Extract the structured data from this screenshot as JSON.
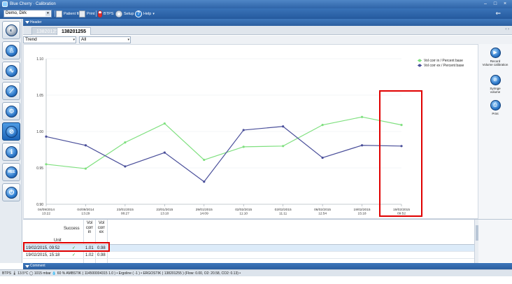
{
  "window": {
    "title": "Blue Cherry · Calibration",
    "minimize": "–",
    "restore": "□",
    "close": "×"
  },
  "toolbar": {
    "user": "Demo, Dirk",
    "patient_file": "Patient file",
    "print": "Print",
    "btps": "BTPS",
    "setup": "Setup",
    "help": "Help",
    "back": "⇐"
  },
  "header": {
    "label": "Header"
  },
  "tabs": [
    {
      "label": "138201255",
      "active": false
    },
    {
      "label": "138201255",
      "active": true
    }
  ],
  "filters": {
    "view": "Trend",
    "scope": "All",
    "arrow": "▾"
  },
  "chart_data": {
    "type": "line",
    "x": [
      "04/09/2014\n13:22",
      "04/09/2014\n13:29",
      "23/01/2015\n08:27",
      "23/01/2015\n13:10",
      "29/01/2015\n14:09",
      "02/02/2015\n11:10",
      "02/02/2015\n11:11",
      "06/02/2015\n12:54",
      "19/02/2015\n15:18",
      "19/02/2015\n09:52"
    ],
    "series": [
      {
        "name": "Vol corr in / Percent base",
        "color": "#7fe07f",
        "values": [
          0.955,
          0.949,
          0.985,
          1.011,
          0.961,
          0.979,
          0.98,
          1.009,
          1.02,
          1.009
        ]
      },
      {
        "name": "Vol corr ex / Percent base",
        "color": "#4a4f9a",
        "values": [
          0.993,
          0.981,
          0.952,
          0.971,
          0.931,
          1.002,
          1.007,
          0.964,
          0.981,
          0.98
        ]
      }
    ],
    "yticks": [
      "1.10",
      "1.05",
      "1.00",
      "0.95",
      "0.90"
    ],
    "ylim": [
      0.9,
      1.1
    ],
    "grid": true,
    "legend": "top-right"
  },
  "right_panel": {
    "record": "Record\nVolume calibration",
    "syringe": "Syringe\nvolume",
    "print": "Print"
  },
  "table": {
    "headers": {
      "success": "Success",
      "vol_corr_in": "Vol\ncorr\nin",
      "vol_corr_ex": "Vol\ncorr\nex",
      "unit": "Unit"
    },
    "rows": [
      {
        "date": "19/02/2015, 09:52",
        "success": "✓",
        "in": "1.01",
        "ex": "0.98"
      },
      {
        "date": "19/02/2015, 15:18",
        "success": "✓",
        "in": "1.02",
        "ex": "0.98"
      }
    ]
  },
  "comment": {
    "label": "Comment"
  },
  "status": {
    "text": "BTPS  🌡 13.5°C  ◯ 1015 mbar  💧 60 %  AMBSTIK ( 114500004315 1.0 )  •  Ergoline ( -1 )  •  ERGOSTIK ( 138201255 ) (Flow: 0.00, O2: 20.58, CO2: 0.13)  •"
  }
}
